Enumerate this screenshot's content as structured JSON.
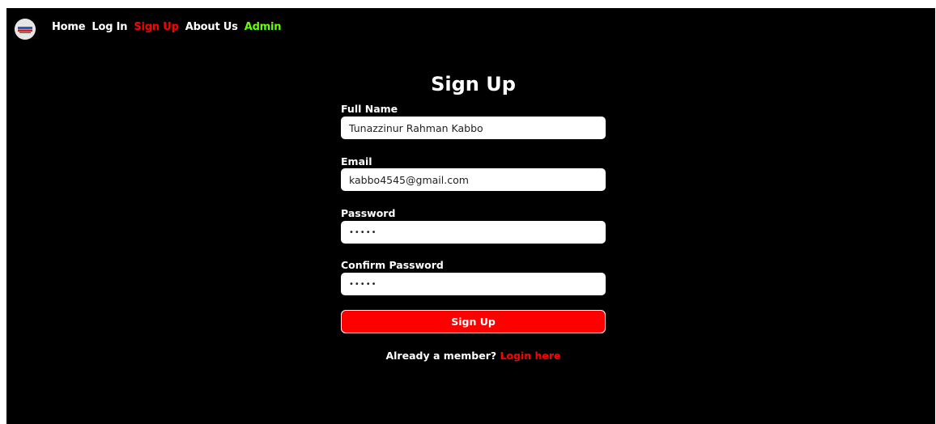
{
  "colors": {
    "background": "#000000",
    "text": "#ffffff",
    "accent_red": "#ff0000",
    "accent_green": "#66ff00",
    "input_bg": "#ffffff"
  },
  "navbar": {
    "logo_icon": "site-logo",
    "links": [
      {
        "label": "Home",
        "color": "#ffffff",
        "active": false
      },
      {
        "label": "Log In",
        "color": "#ffffff",
        "active": false
      },
      {
        "label": "Sign Up",
        "color": "#ff0000",
        "active": true
      },
      {
        "label": "About Us",
        "color": "#ffffff",
        "active": false
      },
      {
        "label": "Admin",
        "color": "#66ff00",
        "active": false
      }
    ]
  },
  "form": {
    "title": "Sign Up",
    "fields": {
      "full_name": {
        "label": "Full Name",
        "value": "Tunazzinur Rahman Kabbo"
      },
      "email": {
        "label": "Email",
        "value": "kabbo4545@gmail.com"
      },
      "password": {
        "label": "Password",
        "value": "•••••"
      },
      "confirm_password": {
        "label": "Confirm Password",
        "value": "•••••"
      }
    },
    "submit_label": "Sign Up",
    "submit_color": "#ff0000"
  },
  "footer": {
    "prompt": "Already a member?",
    "link_label": "Login here",
    "link_color": "#ff0000"
  }
}
